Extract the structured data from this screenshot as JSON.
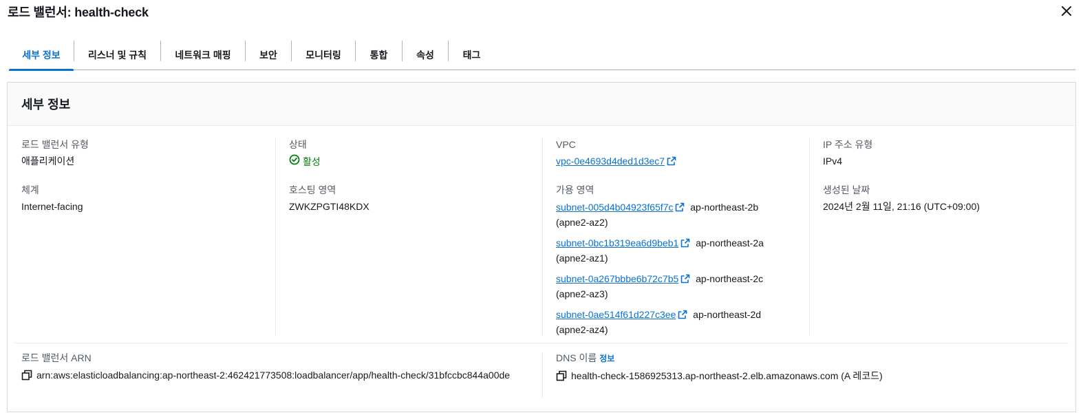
{
  "header": {
    "title": "로드 밸런서: health-check",
    "close_icon": "close-icon"
  },
  "tabs": [
    {
      "label": "세부 정보",
      "active": true
    },
    {
      "label": "리스너 및 규칙"
    },
    {
      "label": "네트워크 매핑"
    },
    {
      "label": "보안"
    },
    {
      "label": "모니터링"
    },
    {
      "label": "통합"
    },
    {
      "label": "속성"
    },
    {
      "label": "태그"
    }
  ],
  "details": {
    "heading": "세부 정보",
    "lb_type": {
      "label": "로드 밸런서 유형",
      "value": "애플리케이션"
    },
    "scheme": {
      "label": "체계",
      "value": "Internet-facing"
    },
    "state": {
      "label": "상태",
      "value": "활성",
      "color": "#037f0c",
      "icon": "status-positive-icon"
    },
    "hosted_zone": {
      "label": "호스팅 영역",
      "value": "ZWKZPGTI48KDX"
    },
    "vpc": {
      "label": "VPC",
      "value": "vpc-0e4693d4ded1d3ec7"
    },
    "availability_zones": {
      "label": "가용 영역",
      "items": [
        {
          "subnet": "subnet-005d4b04923f65f7c",
          "zone": "ap-northeast-2b",
          "zone_id": "(apne2-az2)"
        },
        {
          "subnet": "subnet-0bc1b319ea6d9beb1",
          "zone": "ap-northeast-2a",
          "zone_id": "(apne2-az1)"
        },
        {
          "subnet": "subnet-0a267bbbe6b72c7b5",
          "zone": "ap-northeast-2c",
          "zone_id": "(apne2-az3)"
        },
        {
          "subnet": "subnet-0ae514f61d227c3ee",
          "zone": "ap-northeast-2d",
          "zone_id": "(apne2-az4)"
        }
      ]
    },
    "ip_type": {
      "label": "IP 주소 유형",
      "value": "IPv4"
    },
    "created": {
      "label": "생성된 날짜",
      "value": "2024년 2월 11일, 21:16 (UTC+09:00)"
    },
    "arn": {
      "label": "로드 밸런서 ARN",
      "value": "arn:aws:elasticloadbalancing:ap-northeast-2:462421773508:loadbalancer/app/health-check/31bfccbc844a00de"
    },
    "dns": {
      "label": "DNS 이름",
      "info": "정보",
      "value": "health-check-1586925313.ap-northeast-2.elb.amazonaws.com (A 레코드)"
    }
  },
  "colors": {
    "accent": "#0972d3",
    "success": "#037f0c",
    "text": "#16191f",
    "muted": "#545b64"
  }
}
